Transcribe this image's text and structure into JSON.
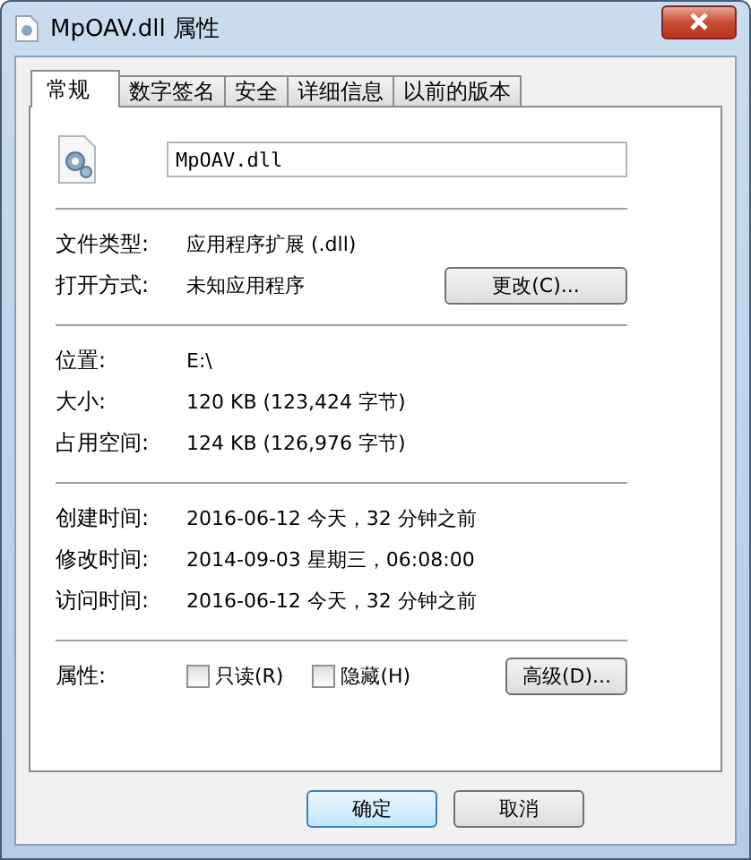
{
  "window": {
    "title": "MpOAV.dll 属性"
  },
  "tabs": [
    {
      "label": "常规",
      "selected": true
    },
    {
      "label": "数字签名",
      "selected": false
    },
    {
      "label": "安全",
      "selected": false
    },
    {
      "label": "详细信息",
      "selected": false
    },
    {
      "label": "以前的版本",
      "selected": false
    }
  ],
  "file_name": "MpOAV.dll",
  "sections": [
    {
      "rows": [
        {
          "label": "文件类型:",
          "value": "应用程序扩展 (.dll)"
        },
        {
          "label": "打开方式:",
          "value": "未知应用程序",
          "button": "更改(C)..."
        }
      ]
    },
    {
      "rows": [
        {
          "label": "位置:",
          "value": "E:\\"
        },
        {
          "label": "大小:",
          "value": "120 KB (123,424 字节)"
        },
        {
          "label": "占用空间:",
          "value": "124 KB (126,976 字节)"
        }
      ]
    },
    {
      "rows": [
        {
          "label": "创建时间:",
          "value": "2016-06-12 今天，32 分钟之前"
        },
        {
          "label": "修改时间:",
          "value": "2014-09-03 星期三，06:08:00"
        },
        {
          "label": "访问时间:",
          "value": "2016-06-12 今天，32 分钟之前"
        }
      ]
    }
  ],
  "attributes": {
    "label": "属性:",
    "checkboxes": [
      {
        "label": "只读(R)",
        "checked": false
      },
      {
        "label": "隐藏(H)",
        "checked": false
      }
    ],
    "advanced_button": "高级(D)..."
  },
  "buttons": [
    {
      "label": "确定",
      "default": true
    },
    {
      "label": "取消",
      "default": false
    }
  ]
}
